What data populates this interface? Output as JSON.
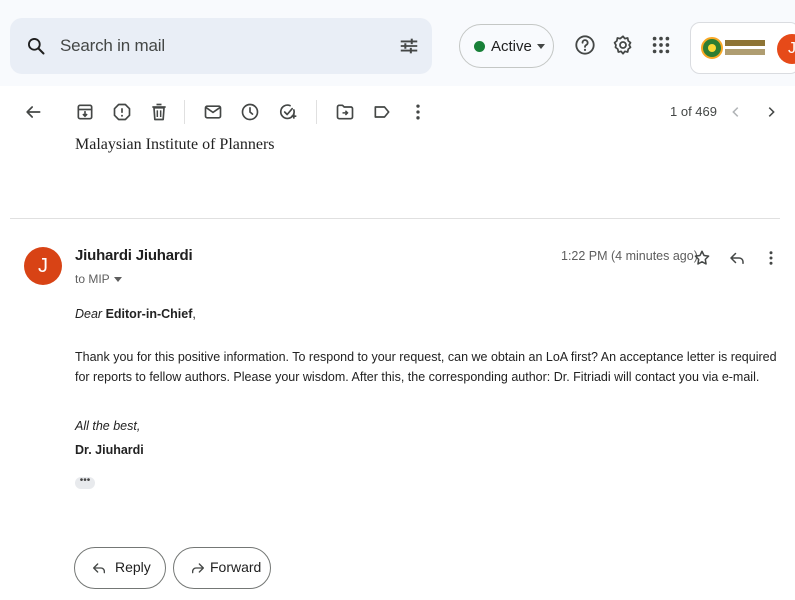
{
  "search": {
    "placeholder": "Search in mail",
    "icon": "search-icon",
    "filter_icon": "tune-icon"
  },
  "status": {
    "label": "Active",
    "color": "#188038"
  },
  "header_icons": [
    "help-icon",
    "gear-icon",
    "apps-grid-icon"
  ],
  "account": {
    "avatar_initial": "J",
    "avatar_color": "#e64a19"
  },
  "toolbar": {
    "icons": [
      "back-arrow-icon",
      "archive-icon",
      "report-spam-icon",
      "delete-icon",
      "mark-unread-icon",
      "snooze-icon",
      "add-task-icon",
      "move-to-icon",
      "label-icon",
      "more-vert-icon"
    ],
    "count": "1 of 469"
  },
  "previous": {
    "snippet": "Malaysian Institute of Planners"
  },
  "message": {
    "sender": "Jiuhardi Jiuhardi",
    "avatar_initial": "J",
    "avatar_color": "#d84315",
    "recipient": "to MIP",
    "timestamp": "1:22 PM (4 minutes ago)",
    "greeting_prefix": "Dear",
    "greeting_name": "Editor-in-Chief",
    "greeting_suffix": ",",
    "body": "Thank you for this positive information. To respond to your request, can we obtain an LoA first? An acceptance letter is required for reports to fellow authors. Please your wisdom. After this, the corresponding author: Dr. Fitriadi will contact you via e-mail.",
    "signoff": "All the best,",
    "signature": "Dr. Jiuhardi",
    "trimmed": "•••"
  },
  "actions": {
    "reply_label": "Reply",
    "forward_label": "Forward"
  }
}
